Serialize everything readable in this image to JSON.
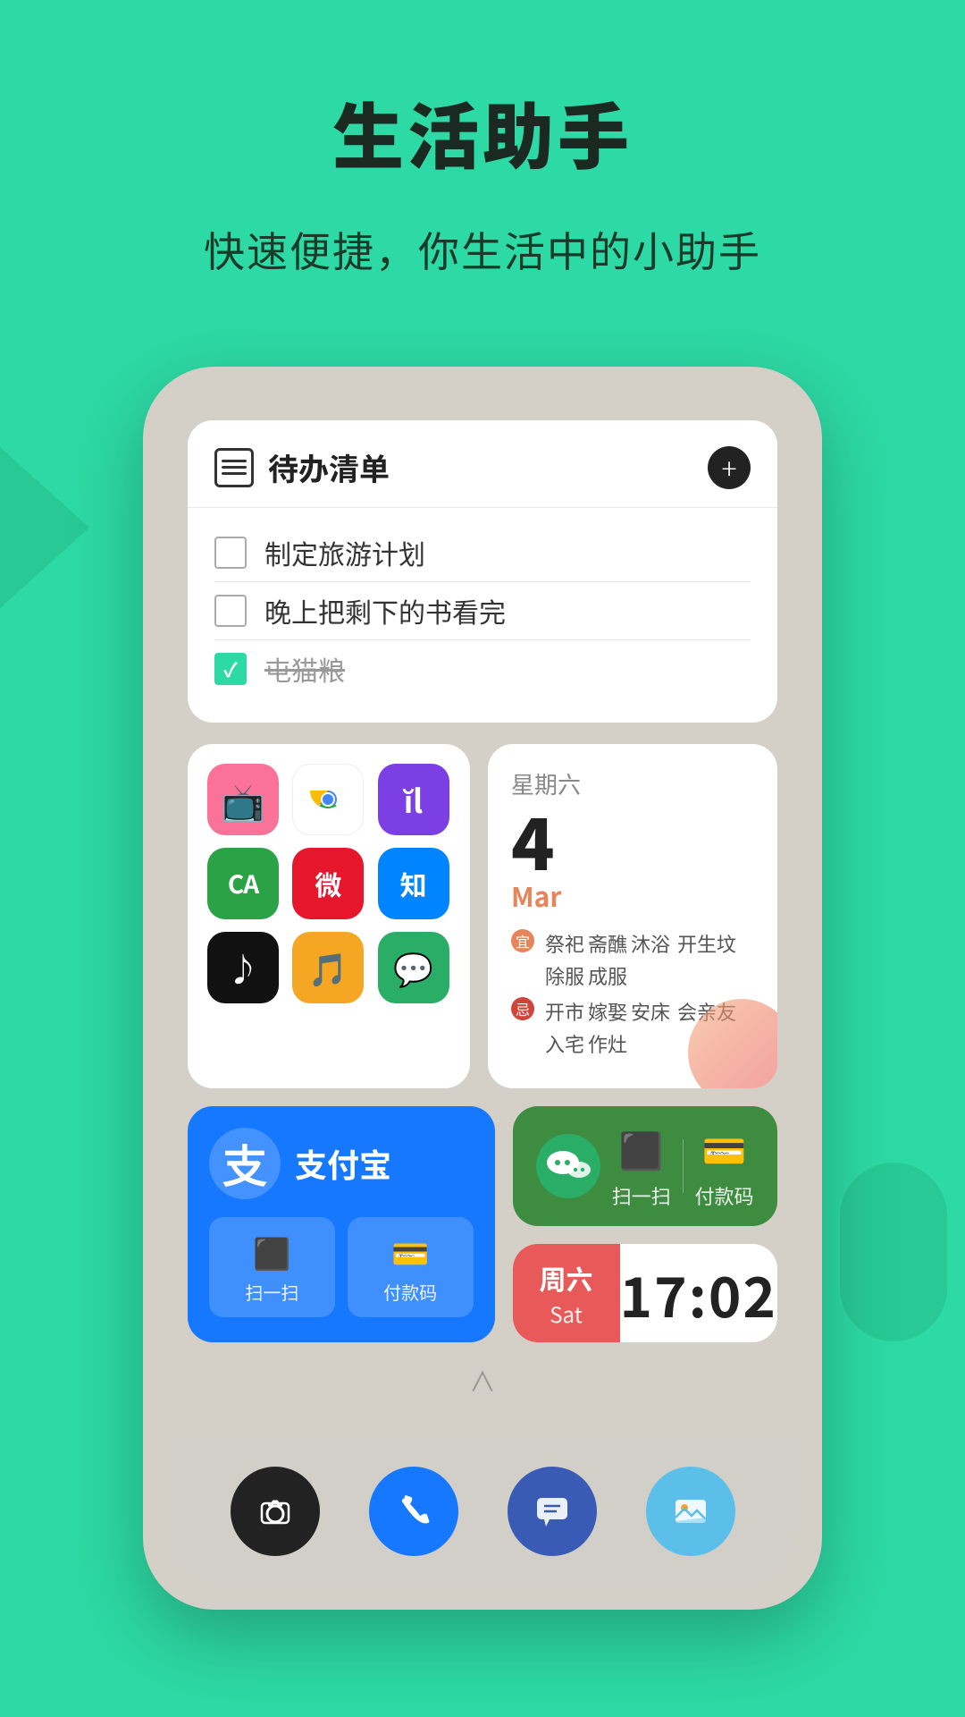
{
  "header": {
    "title": "生活助手",
    "subtitle": "快速便捷，你生活中的小助手"
  },
  "todo_widget": {
    "title": "待办清单",
    "add_label": "+",
    "items": [
      {
        "text": "制定旅游计划",
        "done": false
      },
      {
        "text": "晚上把剩下的书看完",
        "done": false
      },
      {
        "text": "屯猫粮",
        "done": true
      }
    ]
  },
  "app_grid": {
    "apps": [
      {
        "name": "bilibili",
        "emoji": "📺",
        "bg": "#fb7299"
      },
      {
        "name": "chrome",
        "emoji": "🌐",
        "bg": "#ffffff"
      },
      {
        "name": "custom-purple",
        "emoji": "📊",
        "bg": "#7c3fe4"
      },
      {
        "name": "green-app",
        "emoji": "🅰",
        "bg": "#2ba245"
      },
      {
        "name": "weibo",
        "emoji": "微",
        "bg": "#e6162d"
      },
      {
        "name": "zhihu",
        "emoji": "知",
        "bg": "#0084ff"
      },
      {
        "name": "tiktok",
        "emoji": "♪",
        "bg": "#111111"
      },
      {
        "name": "music",
        "emoji": "🎵",
        "bg": "#f5a623"
      },
      {
        "name": "wechat",
        "emoji": "💬",
        "bg": "#2aae67"
      }
    ]
  },
  "calendar_widget": {
    "date_num": "4",
    "day_label": "星期六",
    "month": "Mar",
    "auspicious_label": "宜",
    "auspicious_items": [
      "祭祀",
      "斋醮",
      "沐浴",
      "开生坟",
      "除服",
      "成服"
    ],
    "inauspicious_label": "忌",
    "inauspicious_items": [
      "开市",
      "嫁娶",
      "安床",
      "会亲友",
      "入宅",
      "作灶"
    ]
  },
  "alipay_widget": {
    "logo_char": "支",
    "name": "支付宝",
    "scan_label": "扫一扫",
    "pay_label": "付款码",
    "scan_icon": "⬛",
    "pay_icon": "💳"
  },
  "wechat_pay_widget": {
    "scan_label": "扫一扫",
    "pay_label": "付款码"
  },
  "clock_widget": {
    "day_cn": "周六",
    "day_en": "Sat",
    "time": "17:02"
  },
  "swipe_up": "∧",
  "dock": {
    "camera_label": "相机",
    "phone_label": "电话",
    "message_label": "信息",
    "gallery_label": "相册"
  }
}
